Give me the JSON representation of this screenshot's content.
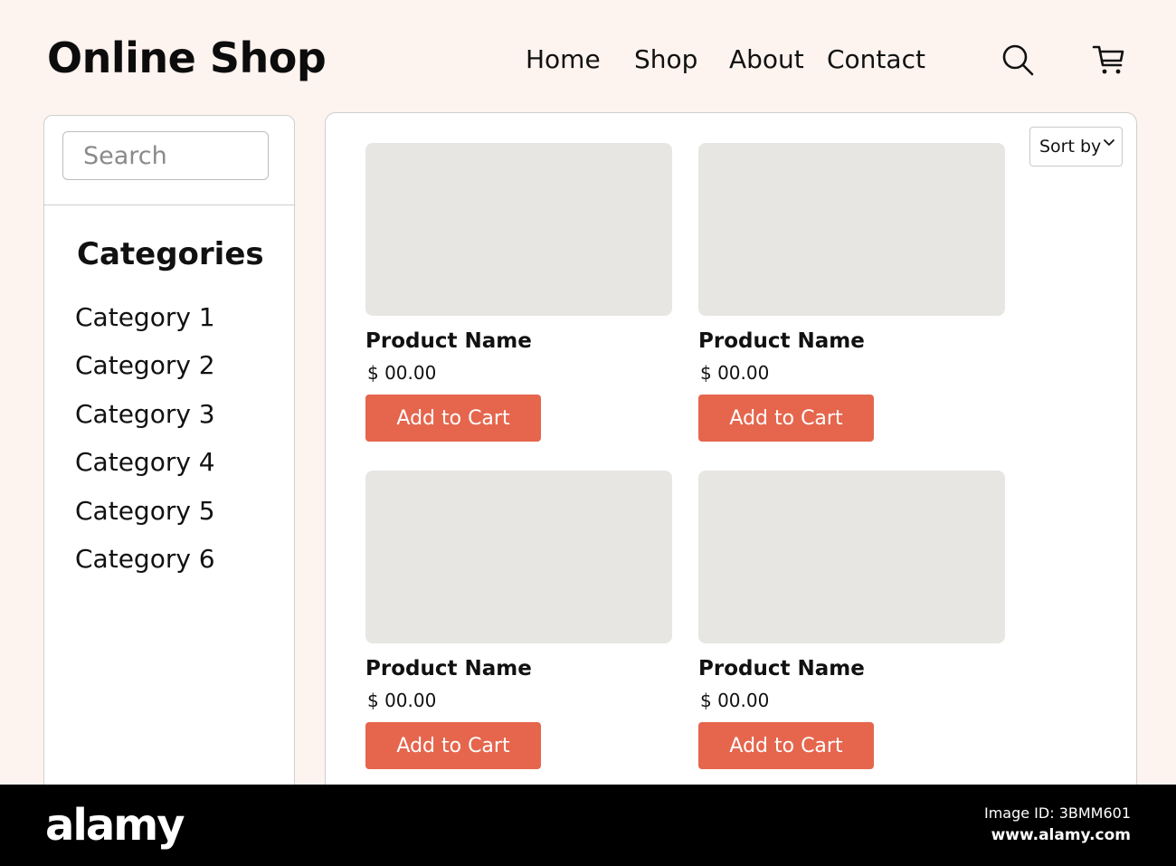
{
  "header": {
    "logo": "Online Shop",
    "nav": [
      "Home",
      "Shop",
      "About",
      "Contact"
    ],
    "search_icon": "search-icon",
    "cart_icon": "cart-icon"
  },
  "sidebar": {
    "search_placeholder": "Search",
    "categories_title": "Categories",
    "categories": [
      "Category 1",
      "Category 2",
      "Category 3",
      "Category 4",
      "Category 5",
      "Category 6"
    ]
  },
  "main": {
    "sort_label": "Sort by",
    "sort_icon": "chevron-down-icon",
    "products": [
      {
        "name": "Product Name",
        "price": "$ 00.00",
        "button": "Add to Cart"
      },
      {
        "name": "Product Name",
        "price": "$ 00.00",
        "button": "Add to Cart"
      },
      {
        "name": "Product Name",
        "price": "$ 00.00",
        "button": "Add to Cart"
      },
      {
        "name": "Product Name",
        "price": "$ 00.00",
        "button": "Add to Cart"
      }
    ]
  },
  "footer": {
    "brand": "alamy",
    "image_id": "Image ID: 3BMM601",
    "url": "www.alamy.com"
  },
  "colors": {
    "page_bg": "#fdf3ef",
    "accent": "#e5664d",
    "placeholder_image": "#e8e6e3",
    "footer_bg": "#000000"
  }
}
